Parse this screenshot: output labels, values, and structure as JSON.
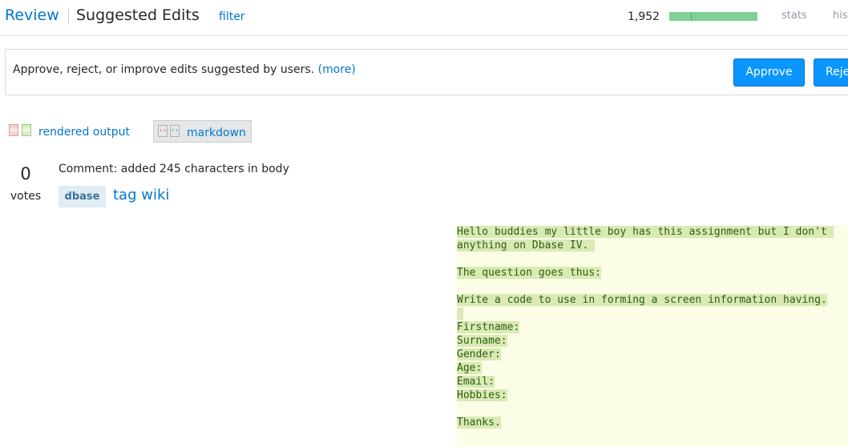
{
  "header": {
    "review": "Review",
    "title": "Suggested Edits",
    "filter": "filter",
    "count": "1,952",
    "progress_fraction": 1.0,
    "stats": "stats",
    "history": "his"
  },
  "instructions": {
    "text": "Approve, reject, or improve edits suggested by users.",
    "more": "(more)"
  },
  "actions": {
    "approve": "Approve",
    "reject": "Reje"
  },
  "view_toggles": {
    "rendered": "rendered output",
    "markdown": "markdown",
    "selected": "markdown"
  },
  "post": {
    "votes": "0",
    "votes_label": "votes",
    "comment": "Comment: added 245 characters in body",
    "tag": "dbase",
    "tag_wiki": "tag wiki"
  },
  "diff": {
    "lines": [
      "Hello buddies my little boy has this assignment but I don't ",
      "anything on Dbase IV. ",
      "",
      "The question goes thus:",
      "",
      "Write a code to use in forming a screen information having.",
      " ",
      "Firstname:",
      "Surname:",
      "Gender:",
      "Age:",
      "Email:",
      "Hobbies:",
      "",
      "Thanks."
    ]
  },
  "colors": {
    "link": "#0077cc",
    "button": "#0a95ff",
    "progress": "#7fcf97",
    "diff_bg": "#fbfde6",
    "diff_highlight": "#d9eab3",
    "tag_bg": "#e1ecf4"
  }
}
